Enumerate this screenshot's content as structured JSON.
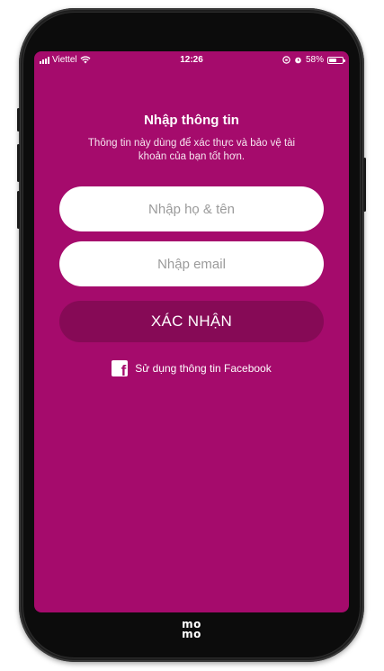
{
  "status_bar": {
    "carrier": "Viettel",
    "time": "12:26",
    "battery_percent": "58%",
    "battery_level": 0.58,
    "icons": [
      "signal-icon",
      "wifi-icon",
      "orientation-lock-icon",
      "alarm-icon",
      "battery-icon"
    ]
  },
  "form": {
    "title": "Nhập thông tin",
    "subtitle": "Thông tin này dùng để xác thực và bảo vệ tài khoản của bạn tốt hơn.",
    "name_placeholder": "Nhập họ & tên",
    "name_value": "",
    "email_placeholder": "Nhập email",
    "email_value": "",
    "confirm_label": "XÁC NHẬN",
    "facebook_label": "Sử dụng thông tin Facebook",
    "facebook_icon": "facebook-icon"
  },
  "brand": {
    "logo_text": "mo mo"
  },
  "colors": {
    "screen_background": "#a50b6c",
    "confirm_button": "#860a56",
    "field_background": "#ffffff"
  }
}
